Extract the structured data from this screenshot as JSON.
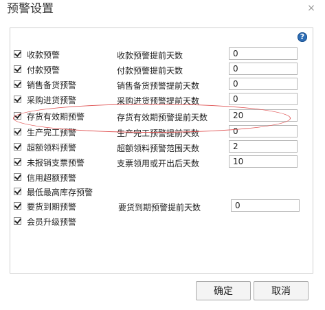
{
  "dialog": {
    "title": "预警设置",
    "help_icon": "question-circle-icon",
    "close_icon": "close-icon",
    "close_glyph": "×",
    "help_glyph": "?"
  },
  "rows": [
    {
      "label": "收款预警",
      "checked": true,
      "param_label": "收款预警提前天数",
      "value": "0"
    },
    {
      "label": "付款预警",
      "checked": true,
      "param_label": "付款预警提前天数",
      "value": "0"
    },
    {
      "label": "销售备货预警",
      "checked": true,
      "param_label": "销售备货预警提前天数",
      "value": "0"
    },
    {
      "label": "采购进货预警",
      "checked": true,
      "param_label": "采购进货预警提前天数",
      "value": "0"
    },
    {
      "label": "存货有效期预警",
      "checked": true,
      "param_label": "存货有效期预警提前天数",
      "value": "20"
    },
    {
      "label": "生产完工预警",
      "checked": true,
      "param_label": "生产完工预警提前天数",
      "value": "0"
    },
    {
      "label": "超额领料预警",
      "checked": true,
      "param_label": "超额领料预警范围天数",
      "value": "2"
    },
    {
      "label": "未报销支票预警",
      "checked": true,
      "param_label": "支票领用或开出后天数",
      "value": "10"
    },
    {
      "label": "信用超额预警",
      "checked": true
    },
    {
      "label": "最低最高库存预警",
      "checked": true
    },
    {
      "label": "要货到期预警",
      "checked": true,
      "param_label": "要货到期预警提前天数",
      "value": "0"
    },
    {
      "label": "会员升级预警",
      "checked": true
    }
  ],
  "highlight": {
    "color": "#e05555"
  },
  "buttons": {
    "ok": "确定",
    "cancel": "取消"
  }
}
